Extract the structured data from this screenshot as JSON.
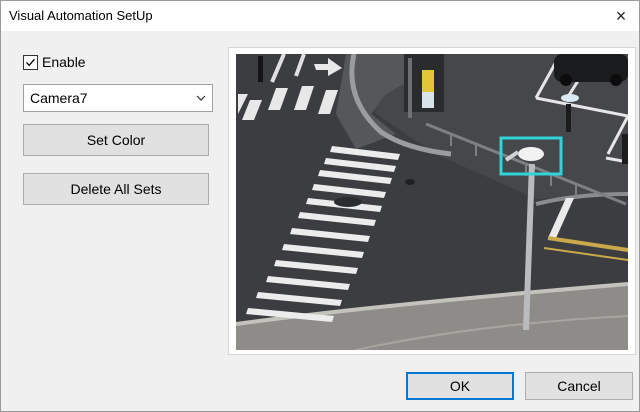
{
  "window": {
    "title": "Visual Automation SetUp",
    "close_glyph": "×"
  },
  "enable": {
    "label": "Enable",
    "checked": true
  },
  "camera_select": {
    "value": "Camera7"
  },
  "buttons": {
    "set_color": "Set Color",
    "delete_all": "Delete All Sets",
    "ok": "OK",
    "cancel": "Cancel"
  },
  "colors": {
    "accent": "#0078d7",
    "selection_box": "#2fd3d8"
  }
}
